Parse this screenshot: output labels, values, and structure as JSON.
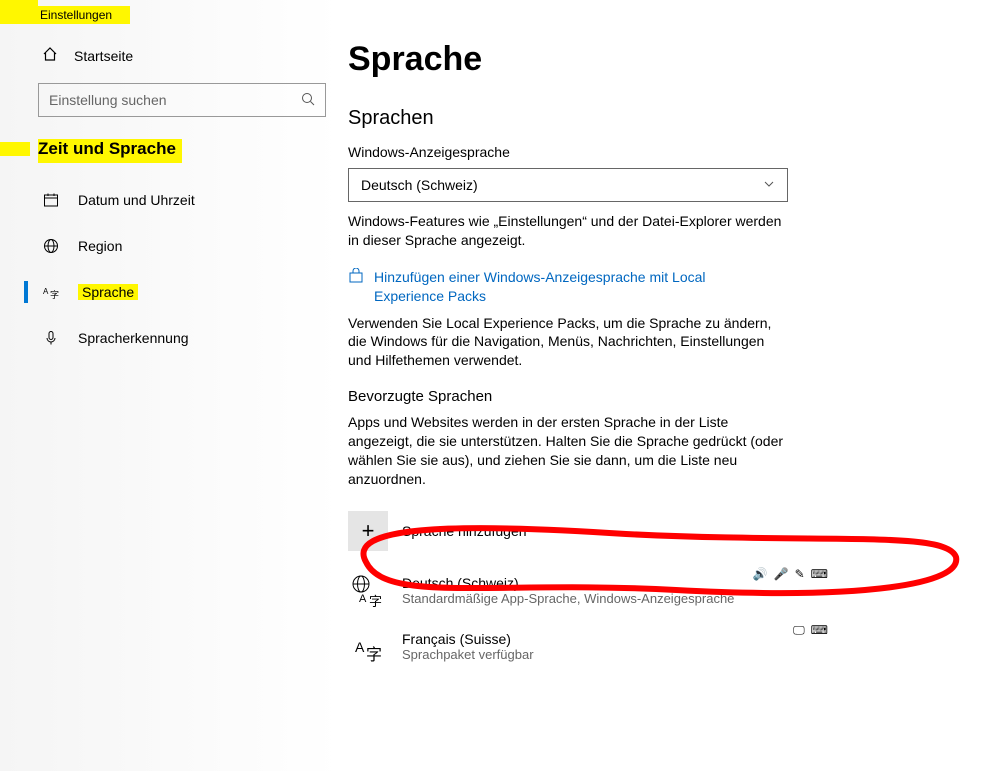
{
  "window": {
    "title": "Einstellungen"
  },
  "sidebar": {
    "home": "Startseite",
    "search_placeholder": "Einstellung suchen",
    "section": "Zeit und Sprache",
    "items": [
      {
        "label": "Datum und Uhrzeit",
        "icon": "calendar-icon",
        "active": false
      },
      {
        "label": "Region",
        "icon": "globe-icon",
        "active": false
      },
      {
        "label": "Sprache",
        "icon": "language-icon",
        "active": true,
        "highlight": true
      },
      {
        "label": "Spracherkennung",
        "icon": "mic-icon",
        "active": false
      }
    ]
  },
  "main": {
    "title": "Sprache",
    "section1": "Sprachen",
    "display_label": "Windows-Anzeigesprache",
    "display_value": "Deutsch (Schweiz)",
    "display_help": "Windows-Features wie „Einstellungen“ und der Datei-Explorer werden in dieser Sprache angezeigt.",
    "link": "Hinzufügen einer Windows-Anzeigesprache mit Local Experience Packs",
    "link_help": "Verwenden Sie Local Experience Packs, um die Sprache zu ändern, die Windows für die Navigation, Menüs, Nachrichten, Einstellungen und Hilfethemen verwendet.",
    "preferred_title": "Bevorzugte Sprachen",
    "preferred_help": "Apps und Websites werden in der ersten Sprache in der Liste angezeigt, die sie unterstützen. Halten Sie die Sprache gedrückt (oder wählen Sie sie aus), und ziehen Sie sie dann, um die Liste neu anzuordnen.",
    "add_label": "Sprache hinzufügen",
    "languages": [
      {
        "name": "Deutsch (Schweiz)",
        "sub": "Standardmäßige App-Sprache, Windows-Anzeigesprache"
      },
      {
        "name": "Français (Suisse)",
        "sub": "Sprachpaket verfügbar"
      }
    ]
  }
}
